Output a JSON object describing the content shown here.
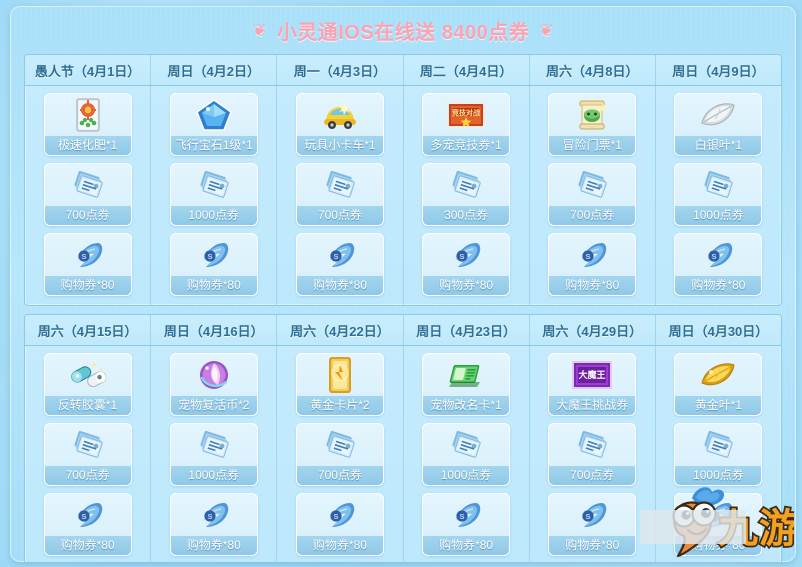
{
  "banner": {
    "deco_left": "❦",
    "deco_right": "❦",
    "title": "小灵通IOS在线送  8400点券",
    "title_color": "#fca2b2"
  },
  "watermark": {
    "name": "jiuyou-logo",
    "text": "九游"
  },
  "theme": {
    "page_bg": "#9ed8f5",
    "frame_bg": "#b6e6fb",
    "grid_border": "#8cc9e8",
    "head_text": "#2e6f95",
    "label_bg": "#98cfea",
    "label_text": "#ffffff"
  },
  "blocks": [
    {
      "id": "april-first-half",
      "columns": [
        {
          "day": "愚人节（4月1日）",
          "items": [
            {
              "label": "极速化肥*1",
              "icon": "fertilizer-bag-icon"
            },
            {
              "label": "700点券",
              "icon": "point-ticket-icon"
            },
            {
              "label": "购物券*80",
              "icon": "shopping-voucher-icon"
            }
          ]
        },
        {
          "day": "周日（4月2日）",
          "items": [
            {
              "label": "飞行宝石1级*1",
              "icon": "flight-gem-icon"
            },
            {
              "label": "1000点券",
              "icon": "point-ticket-icon"
            },
            {
              "label": "购物券*80",
              "icon": "shopping-voucher-icon"
            }
          ]
        },
        {
          "day": "周一（4月3日）",
          "items": [
            {
              "label": "玩具小卡车*1",
              "icon": "toy-car-icon"
            },
            {
              "label": "700点券",
              "icon": "point-ticket-icon"
            },
            {
              "label": "购物券*80",
              "icon": "shopping-voucher-icon"
            }
          ]
        },
        {
          "day": "周二（4月4日）",
          "items": [
            {
              "label": "多宠竞技券*1",
              "icon": "arena-ticket-icon"
            },
            {
              "label": "300点券",
              "icon": "point-ticket-icon"
            },
            {
              "label": "购物券*80",
              "icon": "shopping-voucher-icon"
            }
          ]
        },
        {
          "day": "周六（4月8日）",
          "items": [
            {
              "label": "冒险门票*1",
              "icon": "adventure-scroll-icon"
            },
            {
              "label": "700点券",
              "icon": "point-ticket-icon"
            },
            {
              "label": "购物券*80",
              "icon": "shopping-voucher-icon"
            }
          ]
        },
        {
          "day": "周日（4月9日）",
          "items": [
            {
              "label": "白银叶*1",
              "icon": "silver-leaf-icon"
            },
            {
              "label": "1000点券",
              "icon": "point-ticket-icon"
            },
            {
              "label": "购物券*80",
              "icon": "shopping-voucher-icon"
            }
          ]
        }
      ]
    },
    {
      "id": "april-second-half",
      "columns": [
        {
          "day": "周六（4月15日）",
          "items": [
            {
              "label": "反转胶囊*1",
              "icon": "reverse-capsule-icon"
            },
            {
              "label": "700点券",
              "icon": "point-ticket-icon"
            },
            {
              "label": "购物券*80",
              "icon": "shopping-voucher-icon"
            }
          ]
        },
        {
          "day": "周日（4月16日）",
          "items": [
            {
              "label": "宠物复活币*2",
              "icon": "pet-revive-coin-icon"
            },
            {
              "label": "1000点券",
              "icon": "point-ticket-icon"
            },
            {
              "label": "购物券*80",
              "icon": "shopping-voucher-icon"
            }
          ]
        },
        {
          "day": "周六（4月22日）",
          "items": [
            {
              "label": "黄金卡片*2",
              "icon": "gold-card-icon"
            },
            {
              "label": "700点券",
              "icon": "point-ticket-icon"
            },
            {
              "label": "购物券*80",
              "icon": "shopping-voucher-icon"
            }
          ]
        },
        {
          "day": "周日（4月23日）",
          "items": [
            {
              "label": "宠物改名卡*1",
              "icon": "pet-rename-card-icon"
            },
            {
              "label": "1000点券",
              "icon": "point-ticket-icon"
            },
            {
              "label": "购物券*80",
              "icon": "shopping-voucher-icon"
            }
          ]
        },
        {
          "day": "周六（4月29日）",
          "items": [
            {
              "label": "大魔王挑战券",
              "icon": "demon-king-ticket-icon"
            },
            {
              "label": "700点券",
              "icon": "point-ticket-icon"
            },
            {
              "label": "购物券*80",
              "icon": "shopping-voucher-icon"
            }
          ]
        },
        {
          "day": "周日（4月30日）",
          "items": [
            {
              "label": "黄金叶*1",
              "icon": "gold-leaf-icon"
            },
            {
              "label": "1000点券",
              "icon": "point-ticket-icon"
            },
            {
              "label": "购物券*80",
              "icon": "shopping-voucher-icon"
            }
          ]
        }
      ]
    }
  ]
}
